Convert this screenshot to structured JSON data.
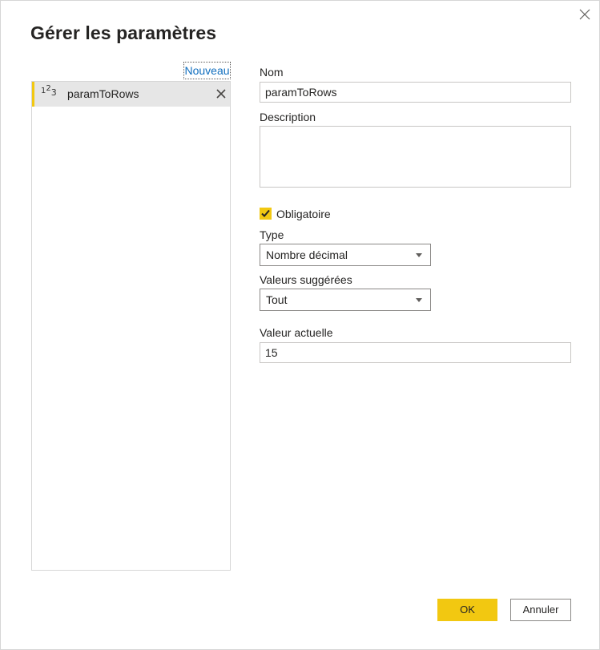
{
  "dialog": {
    "title": "Gérer les paramètres",
    "close_icon": "close-icon"
  },
  "list": {
    "new_label": "Nouveau",
    "items": [
      {
        "type_icon": "number-type-icon",
        "name": "paramToRows",
        "remove_icon": "close-icon"
      }
    ]
  },
  "form": {
    "name_label": "Nom",
    "name_value": "paramToRows",
    "description_label": "Description",
    "description_value": "",
    "required_label": "Obligatoire",
    "required_checked": true,
    "type_label": "Type",
    "type_value": "Nombre décimal",
    "suggested_label": "Valeurs suggérées",
    "suggested_value": "Tout",
    "current_label": "Valeur actuelle",
    "current_value": "15"
  },
  "footer": {
    "ok_label": "OK",
    "cancel_label": "Annuler"
  },
  "colors": {
    "accent": "#f2c811",
    "link": "#106ebe"
  }
}
